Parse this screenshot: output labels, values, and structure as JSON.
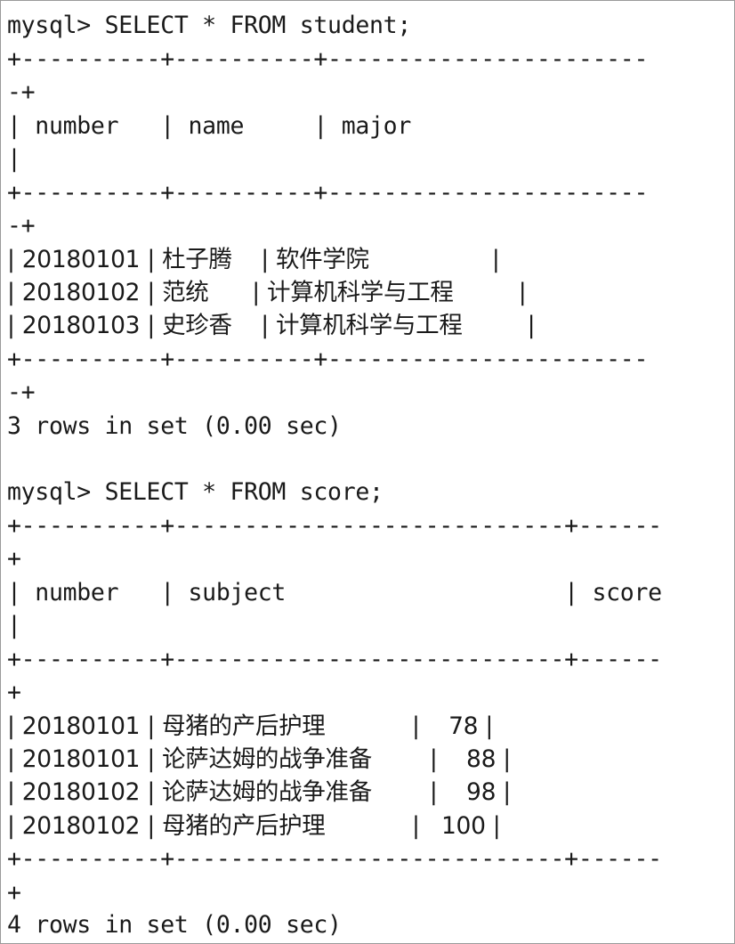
{
  "terminal": {
    "lines": [
      {
        "text": "mysql> SELECT * FROM student;",
        "kind": "prompt"
      },
      {
        "text": "+----------+----------+-----------------------",
        "kind": "border"
      },
      {
        "text": "-+",
        "kind": "border"
      },
      {
        "text": "| number   | name     | major",
        "kind": "header"
      },
      {
        "text": "|",
        "kind": "header"
      },
      {
        "text": "+----------+----------+-----------------------",
        "kind": "border"
      },
      {
        "text": "-+",
        "kind": "border"
      },
      {
        "text": "| 20180101 | 杜子腾    | 软件学院                 |",
        "kind": "row"
      },
      {
        "text": "| 20180102 | 范统      | 计算机科学与工程         |",
        "kind": "row"
      },
      {
        "text": "| 20180103 | 史珍香    | 计算机科学与工程         |",
        "kind": "row"
      },
      {
        "text": "+----------+----------+-----------------------",
        "kind": "border"
      },
      {
        "text": "-+",
        "kind": "border"
      },
      {
        "text": "3 rows in set (0.00 sec)",
        "kind": "status"
      },
      {
        "text": "",
        "kind": "blank"
      },
      {
        "text": "mysql> SELECT * FROM score;",
        "kind": "prompt"
      },
      {
        "text": "+----------+----------------------------+------",
        "kind": "border"
      },
      {
        "text": "+",
        "kind": "border"
      },
      {
        "text": "| number   | subject                    | score",
        "kind": "header"
      },
      {
        "text": "|",
        "kind": "header"
      },
      {
        "text": "+----------+----------------------------+------",
        "kind": "border"
      },
      {
        "text": "+",
        "kind": "border"
      },
      {
        "text": "| 20180101 | 母猪的产后护理            |    78 |",
        "kind": "row"
      },
      {
        "text": "| 20180101 | 论萨达姆的战争准备        |    88 |",
        "kind": "row"
      },
      {
        "text": "| 20180102 | 论萨达姆的战争准备        |    98 |",
        "kind": "row"
      },
      {
        "text": "| 20180102 | 母猪的产后护理            |   100 |",
        "kind": "row"
      },
      {
        "text": "+----------+----------------------------+------",
        "kind": "border"
      },
      {
        "text": "+",
        "kind": "border"
      },
      {
        "text": "4 rows in set (0.00 sec)",
        "kind": "status"
      }
    ]
  }
}
